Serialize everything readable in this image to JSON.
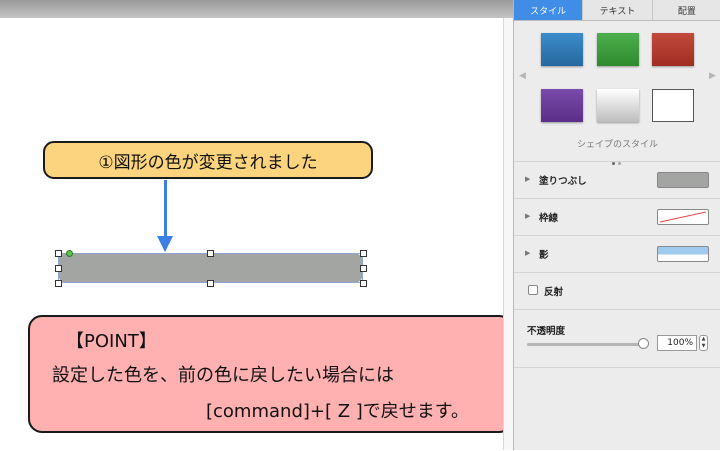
{
  "callout": {
    "text": "①図形の色が変更されました"
  },
  "point_box": {
    "title": "【POINT】",
    "line1": "設定した色を、前の色に戻したい場合には",
    "line2": "[command]+[ Z ]で戻せます。"
  },
  "shape": {
    "fill_color": "#a2a5a2"
  },
  "inspector": {
    "tabs": [
      {
        "label": "スタイル",
        "active": true
      },
      {
        "label": "テキスト",
        "active": false
      },
      {
        "label": "配置",
        "active": false
      }
    ],
    "swatches": [
      {
        "name": "blue",
        "color": "#2f78b8"
      },
      {
        "name": "green",
        "color": "#3e9b3e"
      },
      {
        "name": "red",
        "color": "#b23a2e"
      },
      {
        "name": "purple",
        "color": "#6b3c9a"
      },
      {
        "name": "gray-gradient",
        "color": "#d8d8d8"
      },
      {
        "name": "white",
        "color": "#ffffff"
      }
    ],
    "style_caption": "シェイプのスタイル",
    "fill_label": "塗りつぶし",
    "border_label": "枠線",
    "shadow_label": "影",
    "reflection_label": "反射",
    "opacity_label": "不透明度",
    "opacity_value": "100%",
    "fill_preview_color": "#a2a5a2",
    "shadow_preview_color": "#9fcbef"
  }
}
